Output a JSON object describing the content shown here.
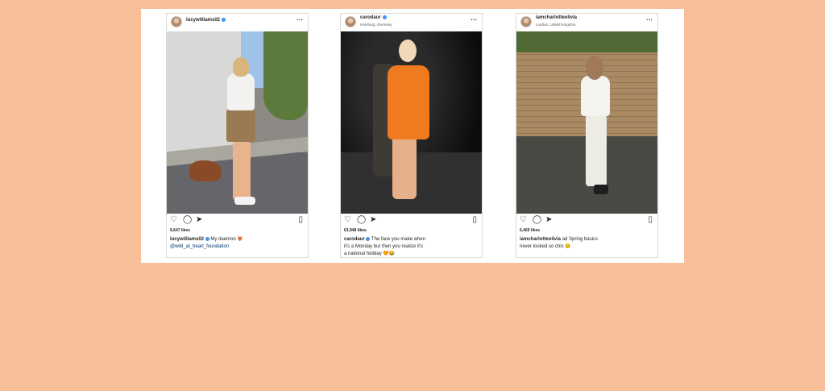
{
  "posts": [
    {
      "username": "lucywilliams02",
      "verified": true,
      "location": "",
      "likes": "9,647 likes",
      "caption_user": "lucywilliams02",
      "caption_line1": "My daemon 🦊",
      "caption_line2": "@wild_at_heart_foundation"
    },
    {
      "username": "carodaur",
      "verified": true,
      "location": "Hamburg, Germany",
      "likes": "63,948 likes",
      "caption_user": "carodaur",
      "caption_line1": "The face you make when",
      "caption_line2": "it's a Monday but then you realize it's",
      "caption_line3": "a national holiday 🧡😂"
    },
    {
      "username": "iamcharlotteolivia",
      "verified": false,
      "location": "London, United Kingdom",
      "likes": "6,469 likes",
      "caption_user": "iamcharlotteolivia",
      "caption_line1": "ad Spring basics",
      "caption_line2": "never looked so chic 😊"
    }
  ],
  "icons": {
    "more": "⋯",
    "heart": "♡",
    "comment": "◯",
    "share": "➤",
    "save": "▯"
  },
  "colors": {
    "background": "#f8bf9a",
    "verified": "#3897f0"
  }
}
